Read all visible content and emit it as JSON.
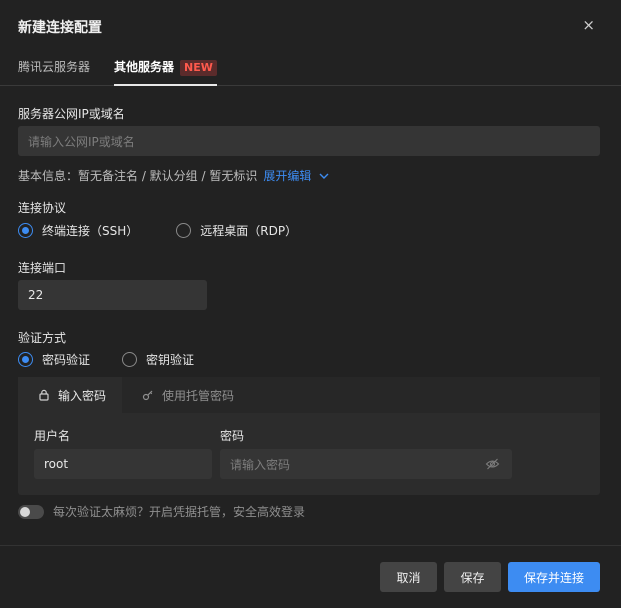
{
  "dialog": {
    "title": "新建连接配置",
    "close_symbol": "×"
  },
  "tabs": [
    {
      "label": "腾讯云服务器",
      "active": false
    },
    {
      "label": "其他服务器",
      "active": true,
      "badge": "NEW"
    }
  ],
  "server": {
    "label": "服务器公网IP或域名",
    "placeholder": "请输入公网IP或域名",
    "value": ""
  },
  "info": {
    "text": "基本信息：暂无备注名 / 默认分组 / 暂无标识",
    "expand_label": "展开编辑"
  },
  "protocol": {
    "label": "连接协议",
    "options": [
      {
        "label": "终端连接（SSH）",
        "selected": true
      },
      {
        "label": "远程桌面（RDP）",
        "selected": false
      }
    ]
  },
  "port": {
    "label": "连接端口",
    "value": "22"
  },
  "auth": {
    "label": "验证方式",
    "options": [
      {
        "label": "密码验证",
        "selected": true
      },
      {
        "label": "密钥验证",
        "selected": false
      }
    ],
    "tabs": [
      {
        "label": "输入密码",
        "icon": "lock-icon",
        "active": true
      },
      {
        "label": "使用托管密码",
        "icon": "key-icon",
        "active": false
      }
    ],
    "username_label": "用户名",
    "username_value": "root",
    "password_label": "密码",
    "password_placeholder": "请输入密码"
  },
  "toggle": {
    "label": "每次验证太麻烦？开启凭据托管，安全高效登录",
    "on": false
  },
  "buttons": {
    "cancel": "取消",
    "save": "保存",
    "save_connect": "保存并连接"
  },
  "colors": {
    "accent": "#3d8cf2",
    "badge": "#ff5a4d",
    "background": "#222222"
  }
}
